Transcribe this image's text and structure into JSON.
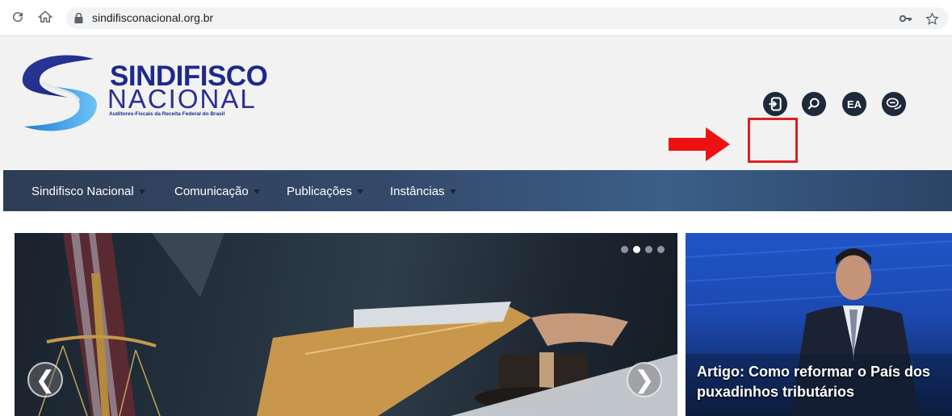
{
  "browser": {
    "url": "sindifisconacional.org.br",
    "icons": [
      "reload-icon",
      "home-icon",
      "lock-icon",
      "key-icon",
      "star-icon"
    ]
  },
  "logo": {
    "title": "SINDIFISCO",
    "subtitle": "NACIONAL",
    "tagline": "Auditores-Fiscais da Receita Federal do Brasil"
  },
  "header_icons": {
    "login": "login-icon",
    "search": "search-icon",
    "ea_label": "EA",
    "chat": "chat-icon"
  },
  "nav": {
    "items": [
      {
        "label": "Sindifisco Nacional"
      },
      {
        "label": "Comunicação"
      },
      {
        "label": "Publicações"
      },
      {
        "label": "Instâncias"
      }
    ]
  },
  "slider": {
    "prev": "❮",
    "next": "❯",
    "dots": 4,
    "active_dot": 2
  },
  "side_news": {
    "title": "Artigo: Como reformar o País dos puxadinhos tributários"
  },
  "colors": {
    "highlight": "#e01e1e",
    "nav_bg": "#34496a",
    "brand_blue": "#1c2a8c"
  }
}
